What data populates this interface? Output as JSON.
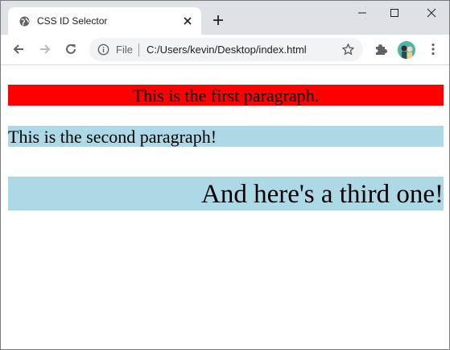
{
  "browser": {
    "tab_title": "CSS ID Selector",
    "omnibox": {
      "scheme_label": "File",
      "url": "C:/Users/kevin/Desktop/index.html"
    }
  },
  "icons": {
    "tab_favicon": "globe-icon",
    "tab_close": "close-icon",
    "new_tab": "plus-icon",
    "minimize": "minimize-icon",
    "maximize": "maximize-icon",
    "close": "close-icon",
    "back": "arrow-left-icon",
    "forward": "arrow-right-icon",
    "reload": "reload-icon",
    "info": "info-icon",
    "bookmark": "star-icon",
    "extensions": "puzzle-icon",
    "profile": "avatar-icon",
    "menu": "kebab-menu-icon"
  },
  "page": {
    "paragraphs": [
      {
        "text": "This is the first paragraph.",
        "background": "#ff0000",
        "align": "center"
      },
      {
        "text": "This is the second paragraph!",
        "background": "#add8e6",
        "align": "left"
      },
      {
        "text": "And here's a third one!",
        "background": "#add8e6",
        "align": "right"
      }
    ]
  }
}
